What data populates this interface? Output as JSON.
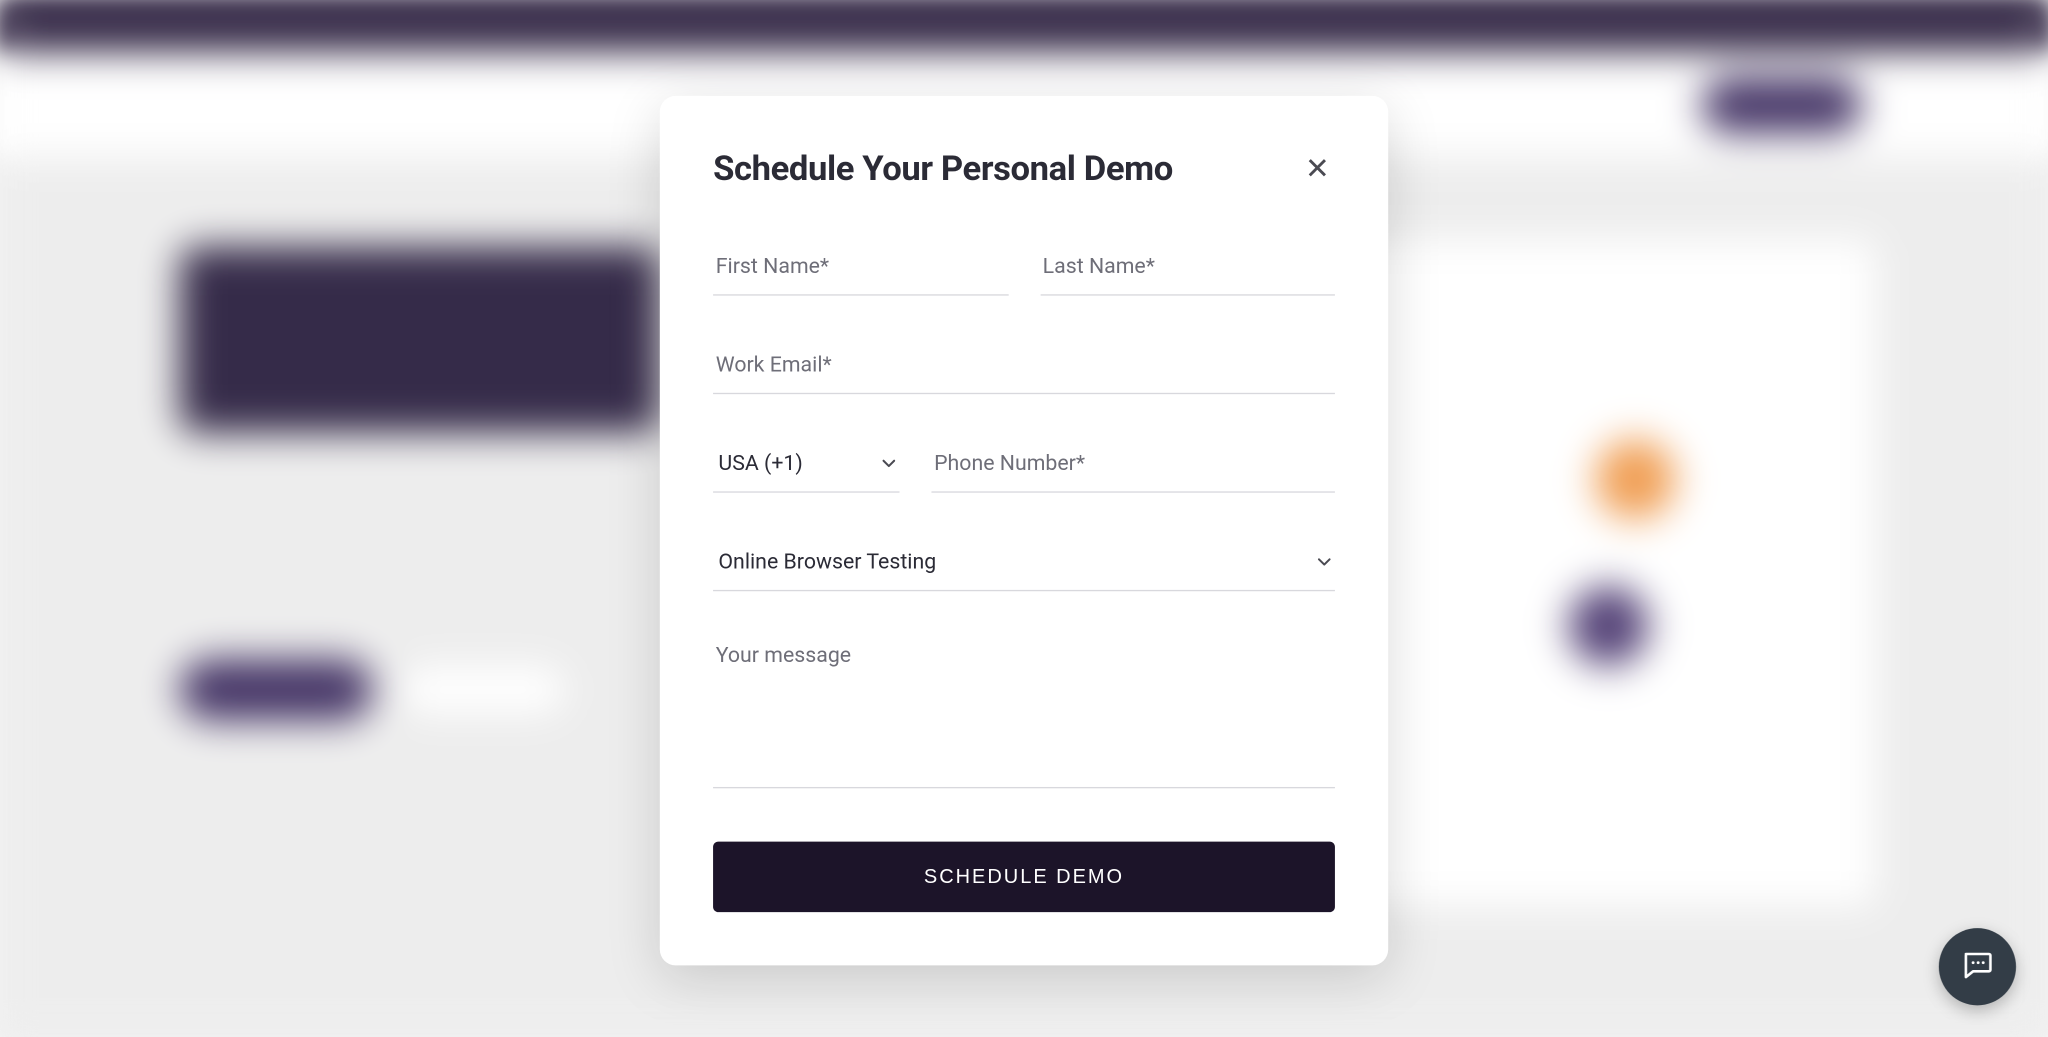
{
  "modal": {
    "title": "Schedule Your Personal Demo",
    "first_name_placeholder": "First Name*",
    "last_name_placeholder": "Last Name*",
    "email_placeholder": "Work Email*",
    "country_code": "USA (+1)",
    "phone_placeholder": "Phone Number*",
    "product_selected": "Online Browser Testing",
    "message_placeholder": "Your message",
    "submit_label": "SCHEDULE DEMO"
  }
}
